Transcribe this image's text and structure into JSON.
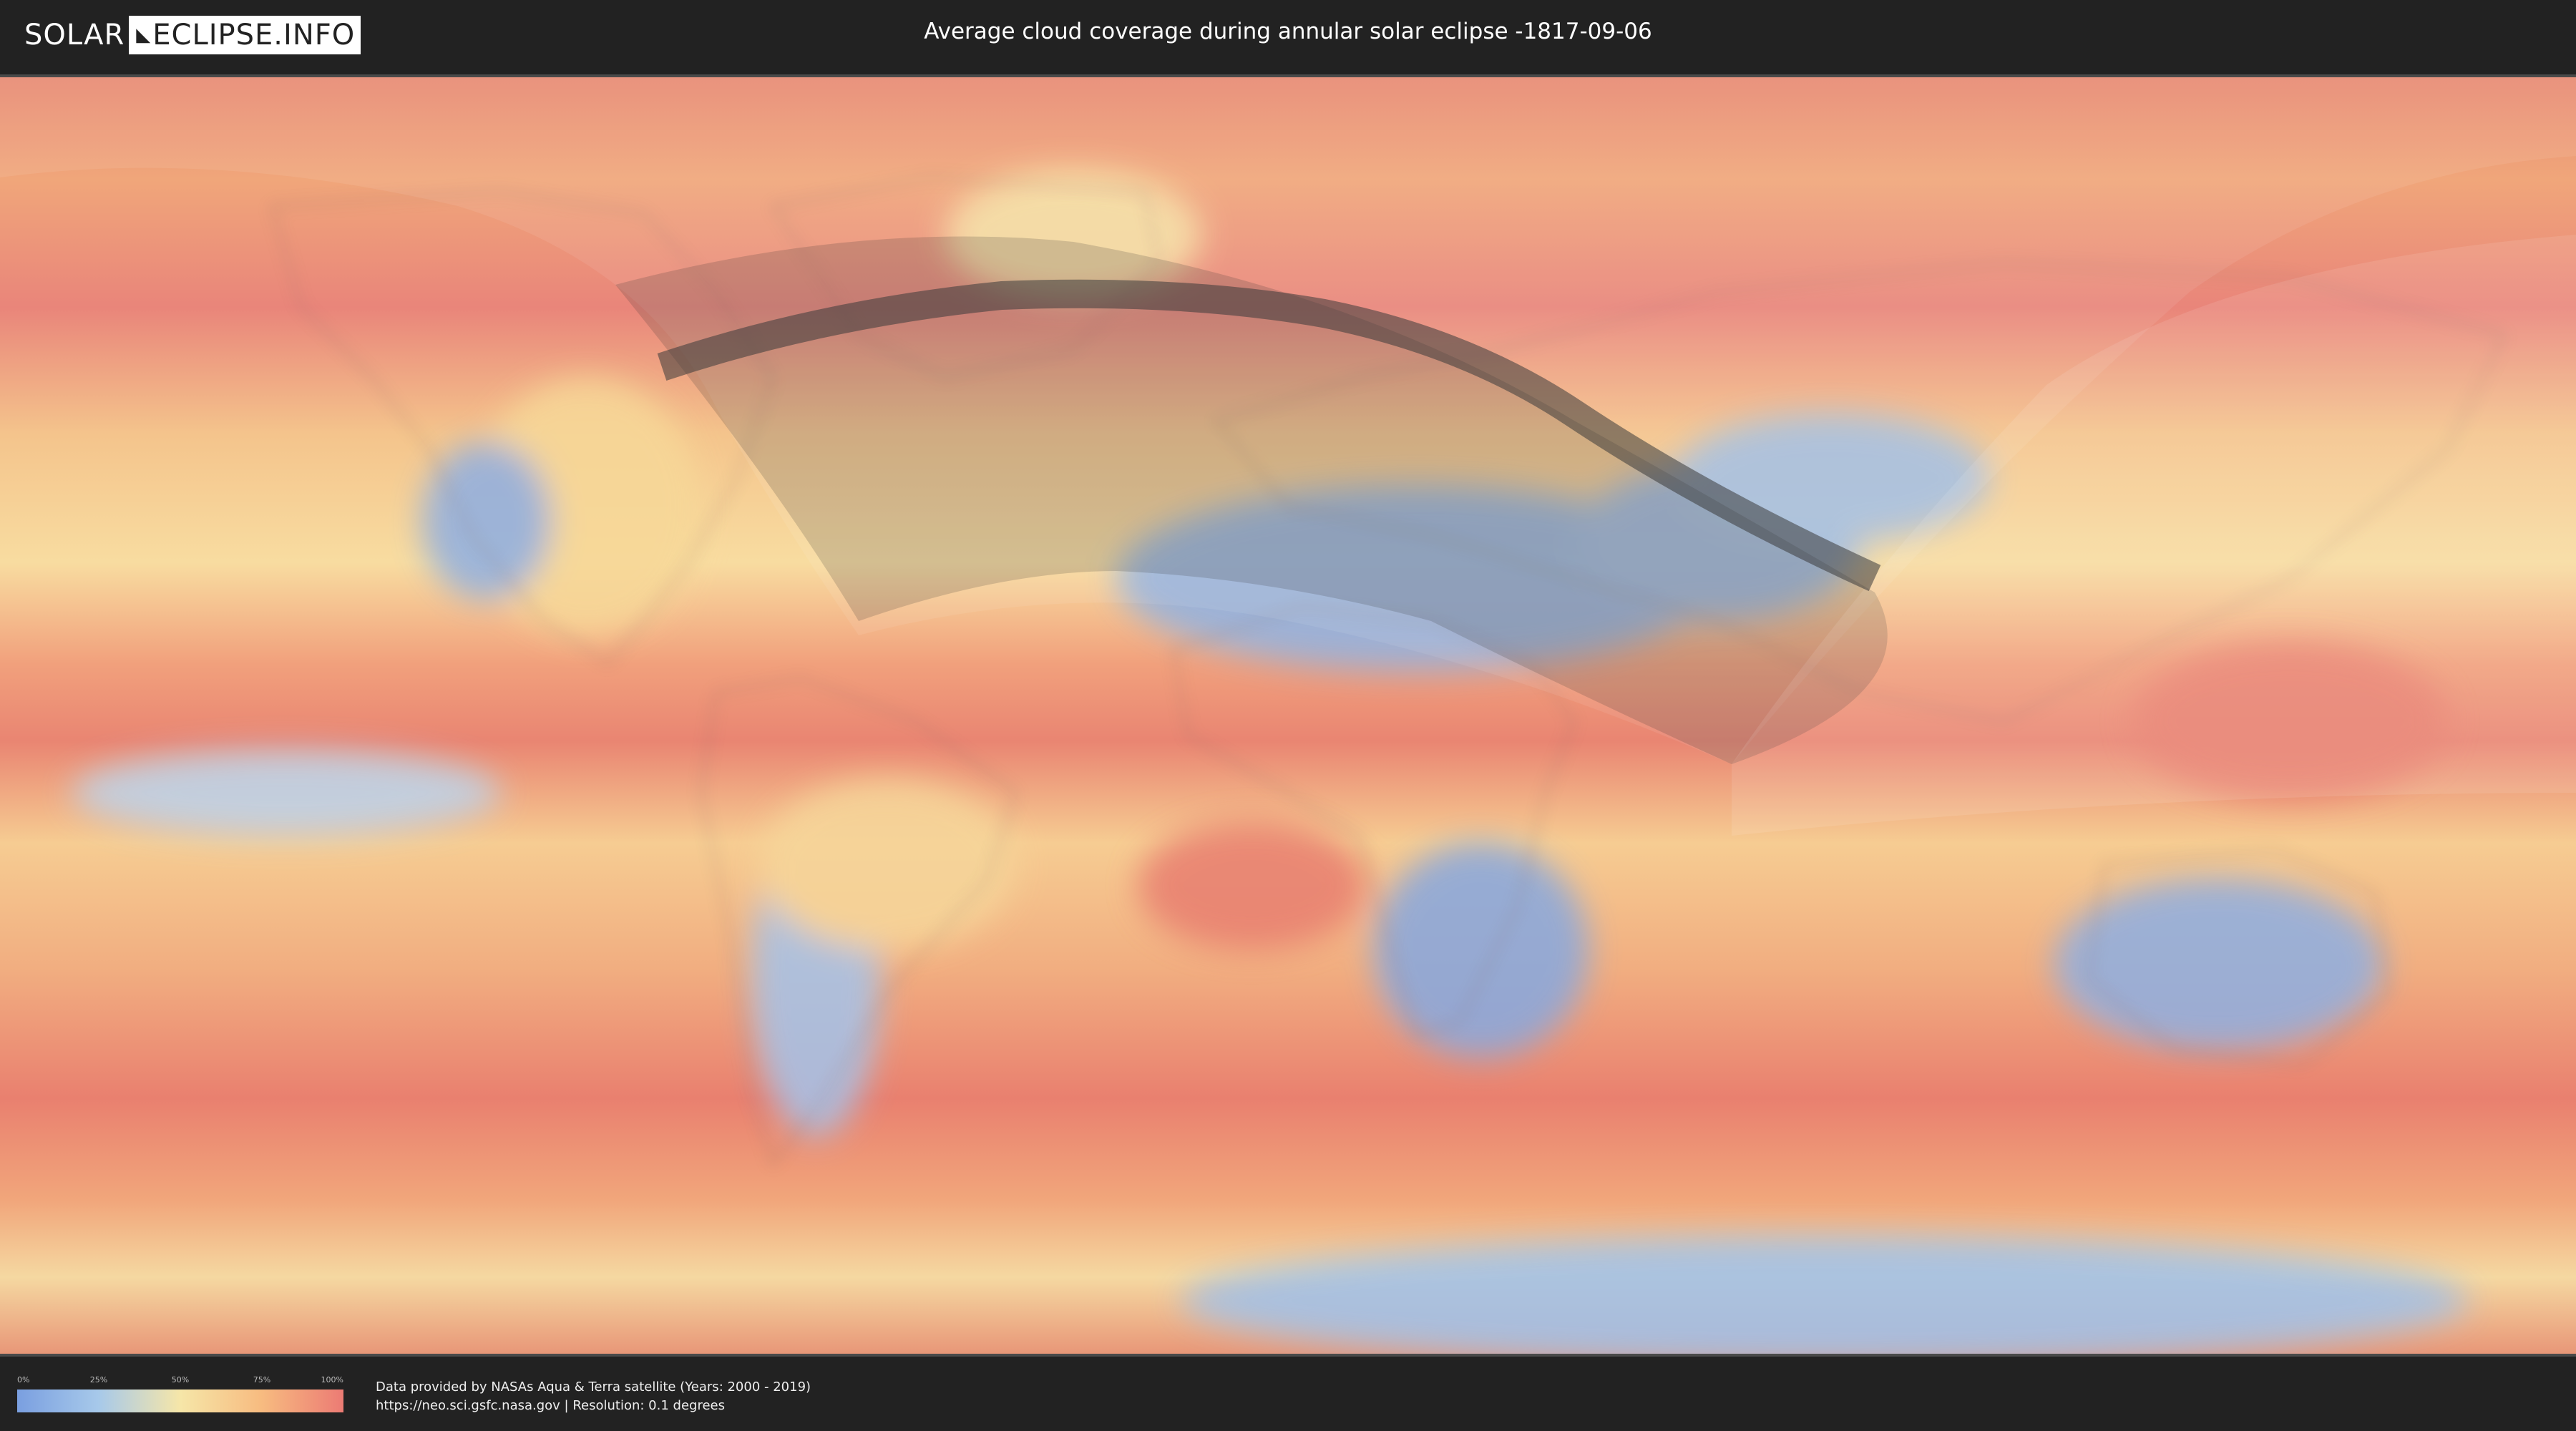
{
  "header": {
    "logo_left": "SOLAR",
    "logo_right": "ECLIPSE.INFO",
    "title": "Average cloud coverage during annular solar eclipse -1817-09-06"
  },
  "legend": {
    "ticks": [
      "0%",
      "25%",
      "50%",
      "75%",
      "100%"
    ],
    "colors": [
      "#7a9fe0",
      "#a7c9ea",
      "#f6e6a8",
      "#f7bb80",
      "#ec7b74"
    ]
  },
  "footer": {
    "source_line1": "Data provided by NASAs Aqua & Terra satellite (Years: 2000 - 2019)",
    "source_line2": "https://neo.sci.gsfc.nasa.gov | Resolution: 0.1 degrees"
  },
  "map": {
    "icons": [
      "world-map",
      "eclipse-path",
      "eclipse-visibility-zone"
    ],
    "colors": {
      "cloudy": "#ec7b74",
      "clear": "#7a9fe0",
      "medium": "#f6e6a8",
      "shadow": "#3a3a3a"
    }
  }
}
